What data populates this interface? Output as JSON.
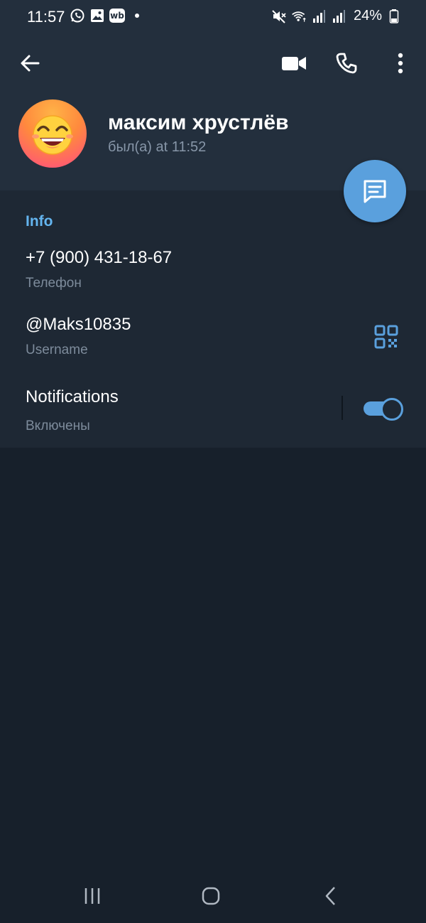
{
  "status_bar": {
    "time": "11:57",
    "notification_icons": [
      "whatsapp-icon",
      "gallery-icon",
      "wb-icon"
    ],
    "wb_label": "wb",
    "battery": "24%",
    "system_icons": [
      "mute-icon",
      "wifi-icon",
      "signal-icon",
      "signal-icon",
      "battery-icon"
    ]
  },
  "header": {
    "actions": [
      "back-arrow-icon",
      "video-call-icon",
      "phone-icon",
      "more-vert-icon"
    ]
  },
  "profile": {
    "name": "максим хрустлёв",
    "last_seen": "был(а) at 11:52",
    "avatar": "emoji-face-avatar"
  },
  "info": {
    "section_title": "Info",
    "phone_value": "+7 (900) 431-18-67",
    "phone_label": "Телефон",
    "username_value": "@Maks10835",
    "username_label": "Username",
    "notifications_title": "Notifications",
    "notifications_status": "Включены",
    "notifications_enabled": true
  },
  "nav_bar": [
    "recents-icon",
    "home-icon",
    "back-icon"
  ],
  "colors": {
    "accent": "#5aa0dd",
    "header_bg": "#232f3d",
    "section_bg": "#1e2834",
    "page_bg": "#17202b",
    "info_title": "#64b5ef"
  }
}
